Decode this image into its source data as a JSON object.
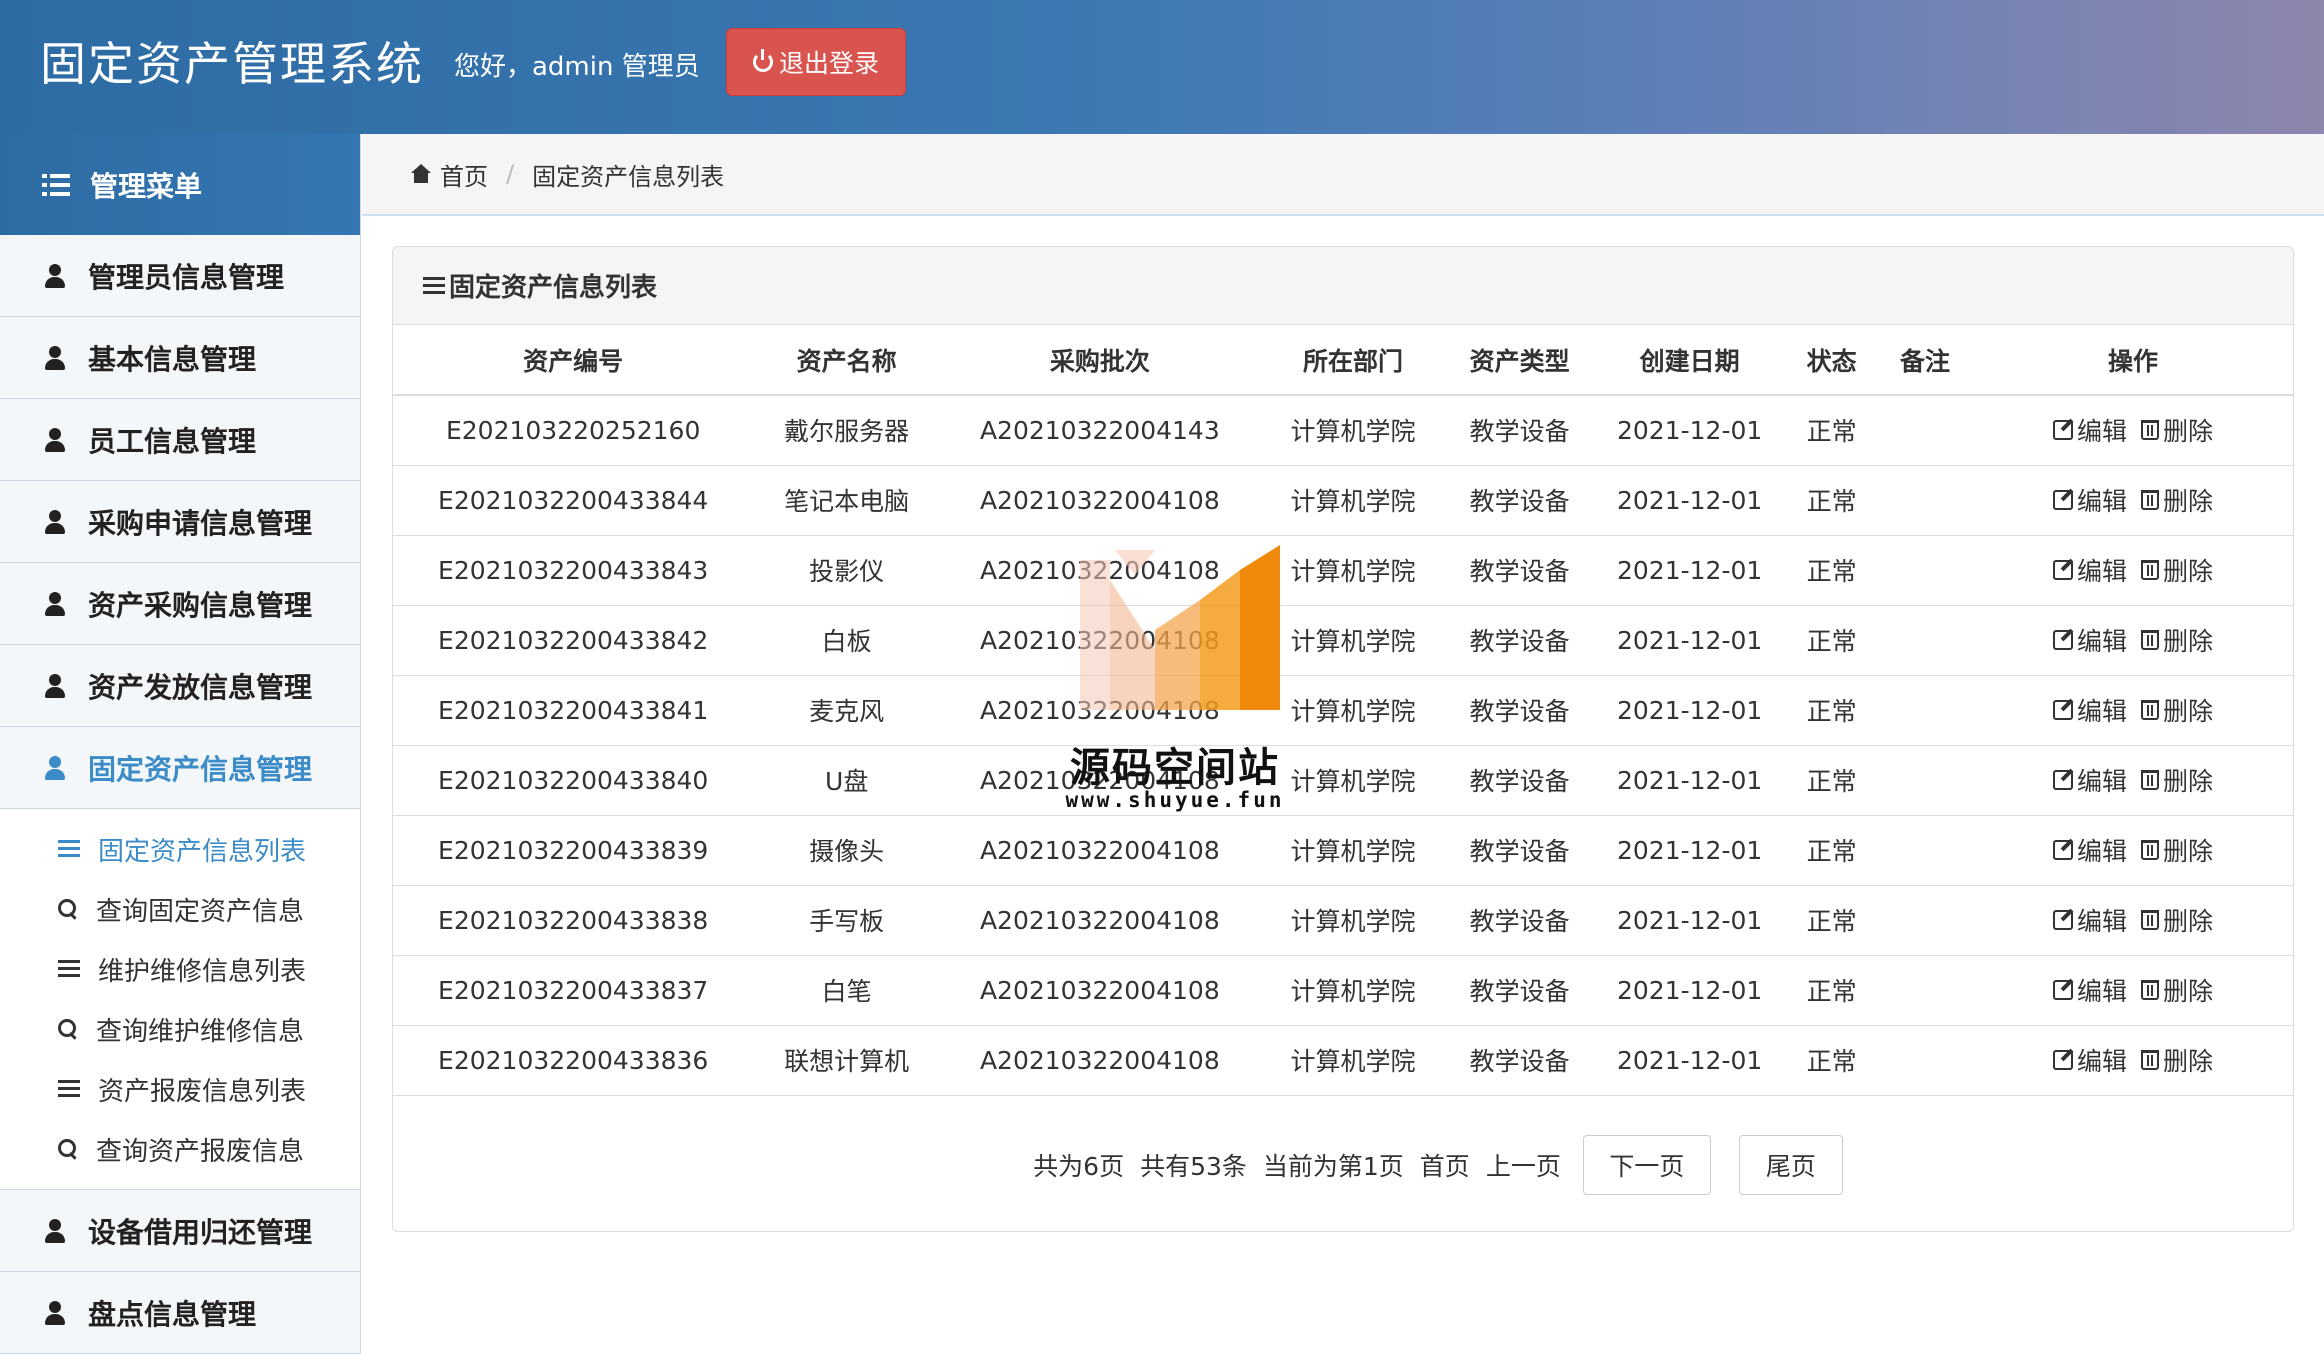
{
  "header": {
    "app_title": "固定资产管理系统",
    "greeting": "您好，admin  管理员",
    "logout_label": "退出登录"
  },
  "sidebar": {
    "title": "管理菜单",
    "items": [
      {
        "label": "管理员信息管理"
      },
      {
        "label": "基本信息管理"
      },
      {
        "label": "员工信息管理"
      },
      {
        "label": "采购申请信息管理"
      },
      {
        "label": "资产采购信息管理"
      },
      {
        "label": "资产发放信息管理"
      },
      {
        "label": "固定资产信息管理"
      },
      {
        "label": "设备借用归还管理"
      },
      {
        "label": "盘点信息管理"
      }
    ],
    "subitems": [
      {
        "label": "固定资产信息列表"
      },
      {
        "label": "查询固定资产信息"
      },
      {
        "label": "维护维修信息列表"
      },
      {
        "label": "查询维护维修信息"
      },
      {
        "label": "资产报废信息列表"
      },
      {
        "label": "查询资产报废信息"
      }
    ]
  },
  "breadcrumb": {
    "home": "首页",
    "current": "固定资产信息列表"
  },
  "panel": {
    "title": "固定资产信息列表"
  },
  "table": {
    "headers": [
      "资产编号",
      "资产名称",
      "采购批次",
      "所在部门",
      "资产类型",
      "创建日期",
      "状态",
      "备注",
      "操作"
    ],
    "edit_label": "编辑",
    "delete_label": "删除",
    "rows": [
      [
        "E202103220252160",
        "戴尔服务器",
        "A20210322004143",
        "计算机学院",
        "教学设备",
        "2021-12-01",
        "正常",
        ""
      ],
      [
        "E2021032200433844",
        "笔记本电脑",
        "A20210322004108",
        "计算机学院",
        "教学设备",
        "2021-12-01",
        "正常",
        ""
      ],
      [
        "E2021032200433843",
        "投影仪",
        "A20210322004108",
        "计算机学院",
        "教学设备",
        "2021-12-01",
        "正常",
        ""
      ],
      [
        "E2021032200433842",
        "白板",
        "A20210322004108",
        "计算机学院",
        "教学设备",
        "2021-12-01",
        "正常",
        ""
      ],
      [
        "E2021032200433841",
        "麦克风",
        "A20210322004108",
        "计算机学院",
        "教学设备",
        "2021-12-01",
        "正常",
        ""
      ],
      [
        "E2021032200433840",
        "U盘",
        "A20210322004108",
        "计算机学院",
        "教学设备",
        "2021-12-01",
        "正常",
        ""
      ],
      [
        "E2021032200433839",
        "摄像头",
        "A20210322004108",
        "计算机学院",
        "教学设备",
        "2021-12-01",
        "正常",
        ""
      ],
      [
        "E2021032200433838",
        "手写板",
        "A20210322004108",
        "计算机学院",
        "教学设备",
        "2021-12-01",
        "正常",
        ""
      ],
      [
        "E2021032200433837",
        "白笔",
        "A20210322004108",
        "计算机学院",
        "教学设备",
        "2021-12-01",
        "正常",
        ""
      ],
      [
        "E2021032200433836",
        "联想计算机",
        "A20210322004108",
        "计算机学院",
        "教学设备",
        "2021-12-01",
        "正常",
        ""
      ]
    ]
  },
  "pager": {
    "total_pages": "共为6页",
    "total_records": "共有53条",
    "current": "当前为第1页",
    "first": "首页",
    "prev": "上一页",
    "next": "下一页",
    "last": "尾页"
  },
  "watermark": {
    "text": "源码空间站",
    "url": "www.shuyue.fun"
  },
  "colors": {
    "header_start": "#2d6ba3",
    "header_end": "#8d86ad",
    "logout": "#d9534f",
    "active": "#3a8bc7",
    "watermark_orange": "#f39c1f"
  }
}
